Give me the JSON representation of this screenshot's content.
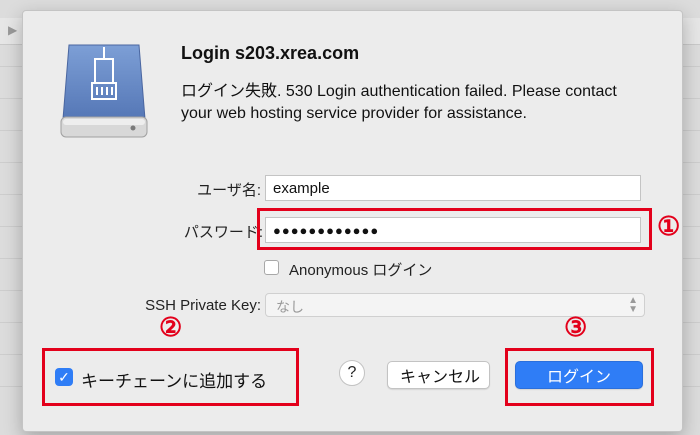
{
  "dialog": {
    "title": "Login s203.xrea.com",
    "message": "ログイン失敗. 530 Login authentication failed. Please contact your web hosting service provider for assistance."
  },
  "form": {
    "username_label": "ユーザ名:",
    "username_value": "example",
    "password_label": "パスワード:",
    "password_value": "●●●●●●●●●●●●",
    "anonymous_label": "Anonymous ログイン",
    "ssh_label": "SSH Private Key:",
    "ssh_value": "なし"
  },
  "footer": {
    "keychain_label": "キーチェーンに追加する",
    "help_label": "?",
    "cancel_label": "キャンセル",
    "login_label": "ログイン"
  },
  "annotations": {
    "one": "①",
    "two": "②",
    "three": "③"
  },
  "colors": {
    "annotation_red": "#e3001b",
    "primary_button": "#2f7df6"
  },
  "icons": {
    "server": "network-drive-icon",
    "check": "checkmark-icon",
    "chevron": "up-down-chevron-icon"
  }
}
